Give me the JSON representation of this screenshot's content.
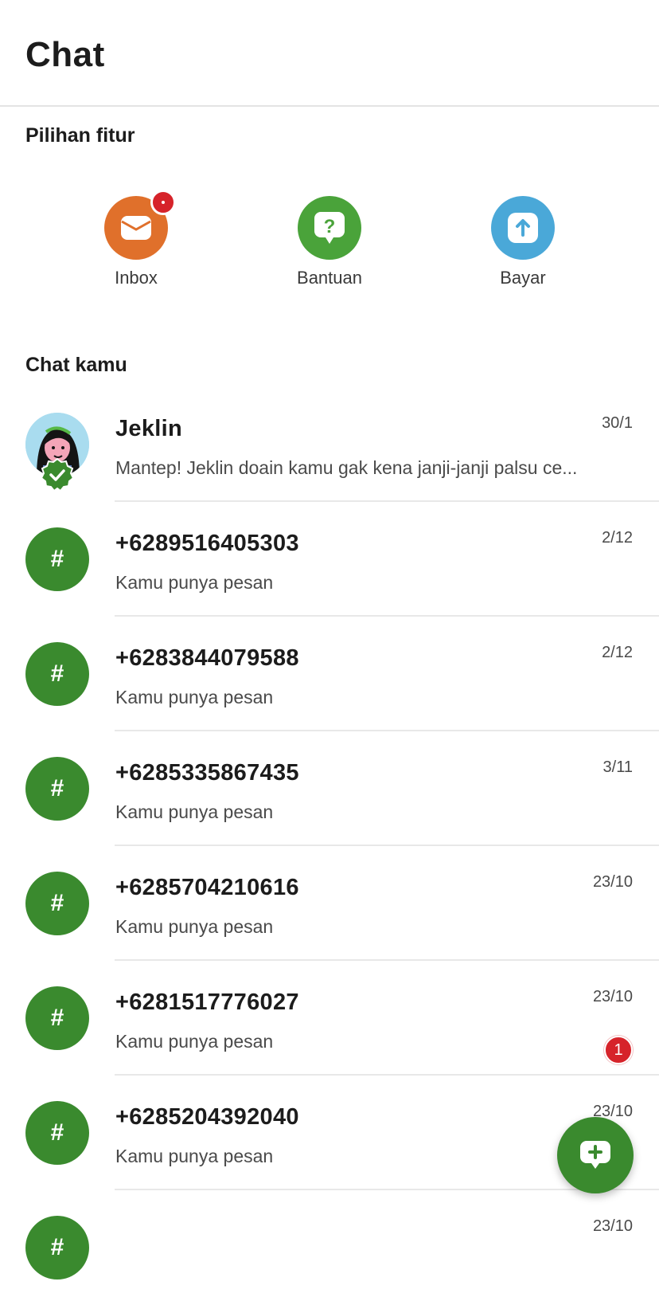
{
  "header": {
    "title": "Chat"
  },
  "features": {
    "title": "Pilihan fitur",
    "items": [
      {
        "label": "Inbox",
        "icon": "mail-icon",
        "color": "#e0702b",
        "has_badge": true
      },
      {
        "label": "Bantuan",
        "icon": "help-bubble-icon",
        "color": "#4aa33a"
      },
      {
        "label": "Bayar",
        "icon": "pay-arrow-up-icon",
        "color": "#4aa8d8"
      }
    ]
  },
  "chats": {
    "title": "Chat kamu",
    "items": [
      {
        "name": "Jeklin",
        "preview": "Mantep! Jeklin doain kamu gak kena janji-janji palsu ce...",
        "date": "30/1",
        "avatar": "jeklin-avatar",
        "verified": true
      },
      {
        "name": "+6289516405303",
        "preview": "Kamu punya pesan",
        "date": "2/12",
        "avatar": "hash"
      },
      {
        "name": "+6283844079588",
        "preview": "Kamu punya pesan",
        "date": "2/12",
        "avatar": "hash"
      },
      {
        "name": "+6285335867435",
        "preview": "Kamu punya pesan",
        "date": "3/11",
        "avatar": "hash"
      },
      {
        "name": "+6285704210616",
        "preview": "Kamu punya pesan",
        "date": "23/10",
        "avatar": "hash"
      },
      {
        "name": "+6281517776027",
        "preview": "Kamu punya pesan",
        "date": "23/10",
        "avatar": "hash",
        "unread": "1"
      },
      {
        "name": "+6285204392040",
        "preview": "Kamu punya pesan",
        "date": "23/10",
        "avatar": "hash"
      },
      {
        "name": "",
        "preview": "",
        "date": "23/10",
        "avatar": "hash"
      }
    ]
  },
  "fab": {
    "icon": "new-chat-icon"
  },
  "colors": {
    "primary_green": "#3a8a2e",
    "badge_red": "#d6232a"
  }
}
